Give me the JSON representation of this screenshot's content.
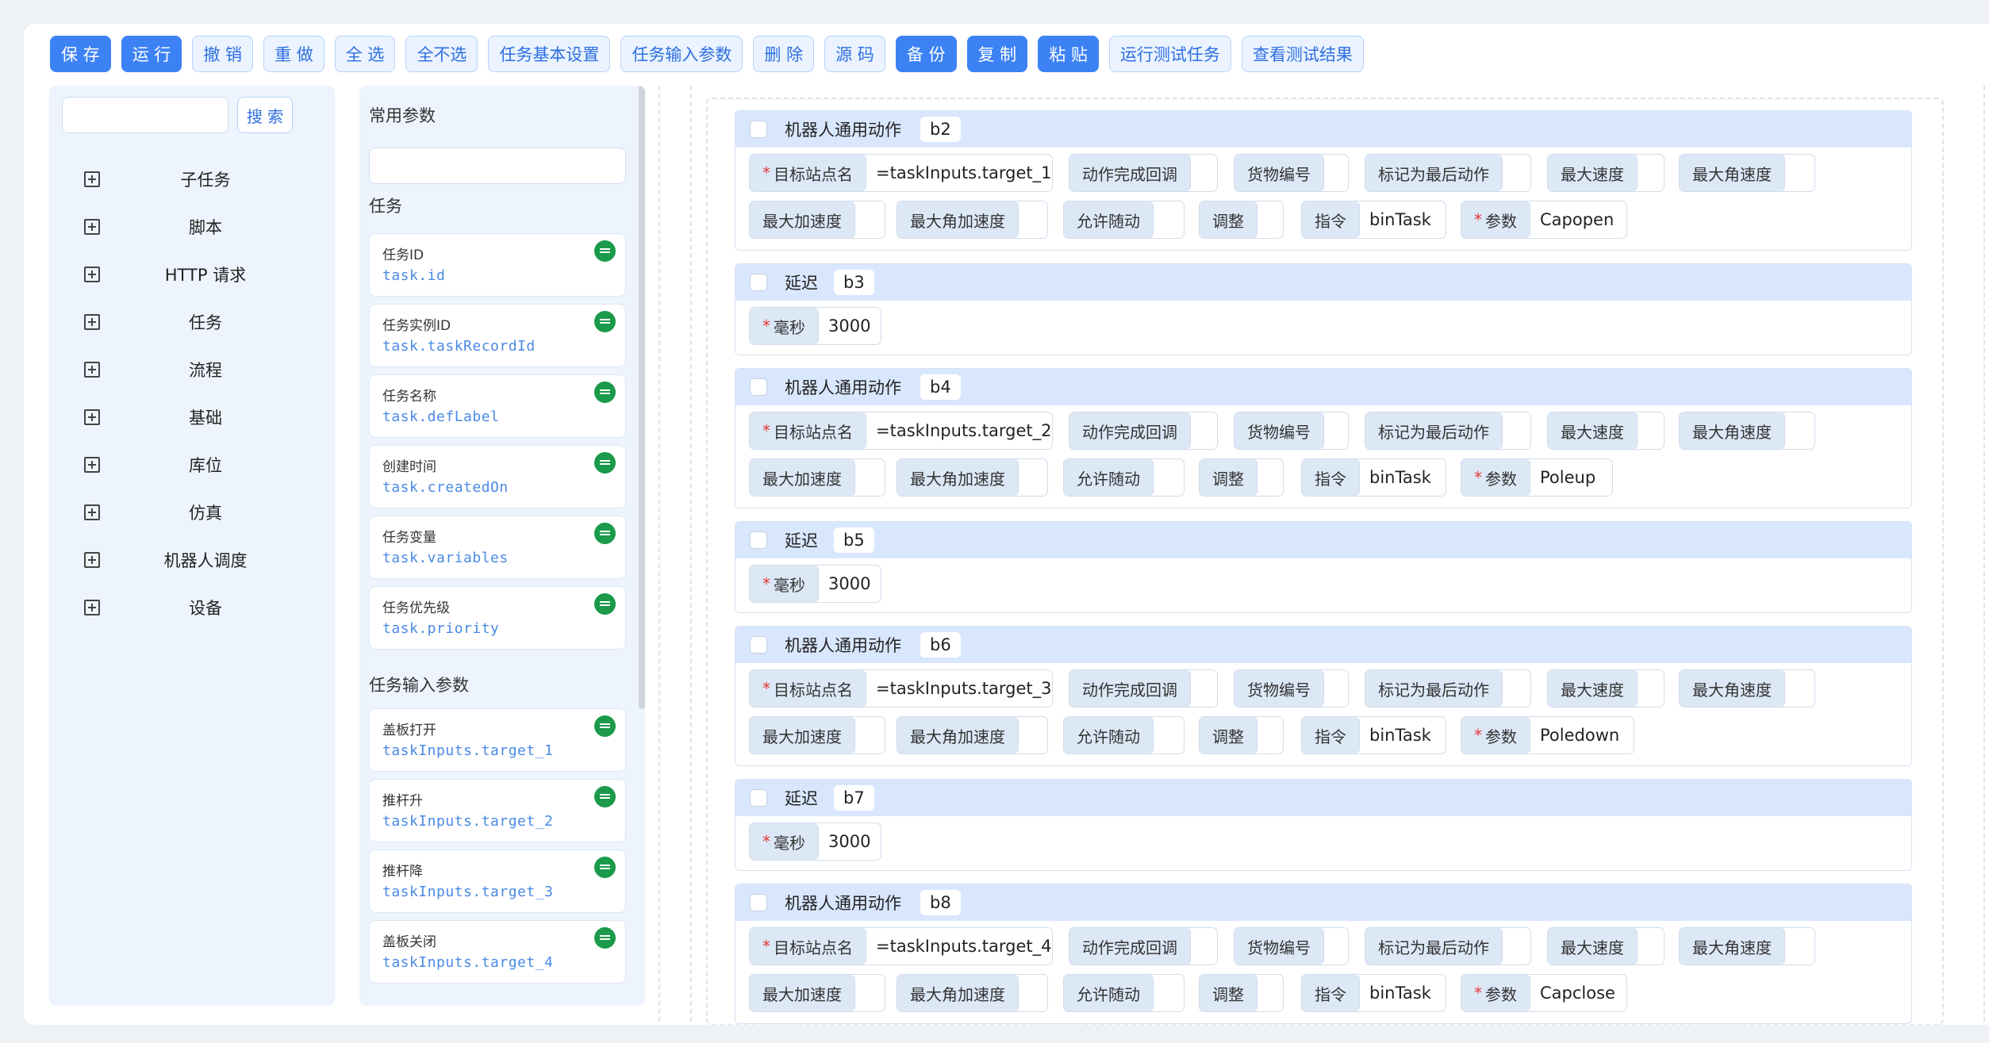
{
  "toolbar": [
    {
      "label": "保 存",
      "primary": true
    },
    {
      "label": "运 行",
      "primary": true
    },
    {
      "label": "撤 销",
      "primary": false
    },
    {
      "label": "重 做",
      "primary": false
    },
    {
      "label": "全 选",
      "primary": false
    },
    {
      "label": "全不选",
      "primary": false
    },
    {
      "label": "任务基本设置",
      "primary": false
    },
    {
      "label": "任务输入参数",
      "primary": false
    },
    {
      "label": "删 除",
      "primary": false
    },
    {
      "label": "源 码",
      "primary": false
    },
    {
      "label": "备 份",
      "primary": true
    },
    {
      "label": "复 制",
      "primary": true
    },
    {
      "label": "粘 贴",
      "primary": true
    },
    {
      "label": "运行测试任务",
      "primary": false
    },
    {
      "label": "查看测试结果",
      "primary": false
    }
  ],
  "search": {
    "placeholder": "",
    "button_label": "搜 索"
  },
  "categories": [
    "子任务",
    "脚本",
    "HTTP 请求",
    "任务",
    "流程",
    "基础",
    "库位",
    "仿真",
    "机器人调度",
    "设备"
  ],
  "mid": {
    "common_title": "常用参数",
    "task_title": "任务",
    "task_params": [
      {
        "name": "任务ID",
        "path": "task.id"
      },
      {
        "name": "任务实例ID",
        "path": "task.taskRecordId"
      },
      {
        "name": "任务名称",
        "path": "task.defLabel"
      },
      {
        "name": "创建时间",
        "path": "task.createdOn"
      },
      {
        "name": "任务变量",
        "path": "task.variables"
      },
      {
        "name": "任务优先级",
        "path": "task.priority"
      }
    ],
    "input_title": "任务输入参数",
    "input_params": [
      {
        "name": "盖板打开",
        "path": "taskInputs.target_1"
      },
      {
        "name": "推杆升",
        "path": "taskInputs.target_2"
      },
      {
        "name": "推杆降",
        "path": "taskInputs.target_3"
      },
      {
        "name": "盖板关闭",
        "path": "taskInputs.target_4"
      }
    ]
  },
  "labels": {
    "robot_action": "机器人通用动作",
    "delay": "延迟",
    "target_station": "目标站点名",
    "callback": "动作完成回调",
    "goods_id": "货物编号",
    "mark_last": "标记为最后动作",
    "max_speed": "最大速度",
    "max_ang_speed": "最大角速度",
    "max_acc": "最大加速度",
    "max_ang_acc": "最大角加速度",
    "allow_follow": "允许随动",
    "adjust": "调整",
    "command": "指令",
    "param": "参数",
    "ms": "毫秒"
  },
  "blocks": [
    {
      "type": "robot",
      "id": "b2",
      "target": "=taskInputs.target_1",
      "command": "binTask",
      "param": "Capopen"
    },
    {
      "type": "delay",
      "id": "b3",
      "ms": "3000"
    },
    {
      "type": "robot",
      "id": "b4",
      "target": "=taskInputs.target_2",
      "command": "binTask",
      "param": "Poleup"
    },
    {
      "type": "delay",
      "id": "b5",
      "ms": "3000"
    },
    {
      "type": "robot",
      "id": "b6",
      "target": "=taskInputs.target_3",
      "command": "binTask",
      "param": "Poledown"
    },
    {
      "type": "delay",
      "id": "b7",
      "ms": "3000"
    },
    {
      "type": "robot",
      "id": "b8",
      "target": "=taskInputs.target_4",
      "command": "binTask",
      "param": "Capclose"
    }
  ]
}
